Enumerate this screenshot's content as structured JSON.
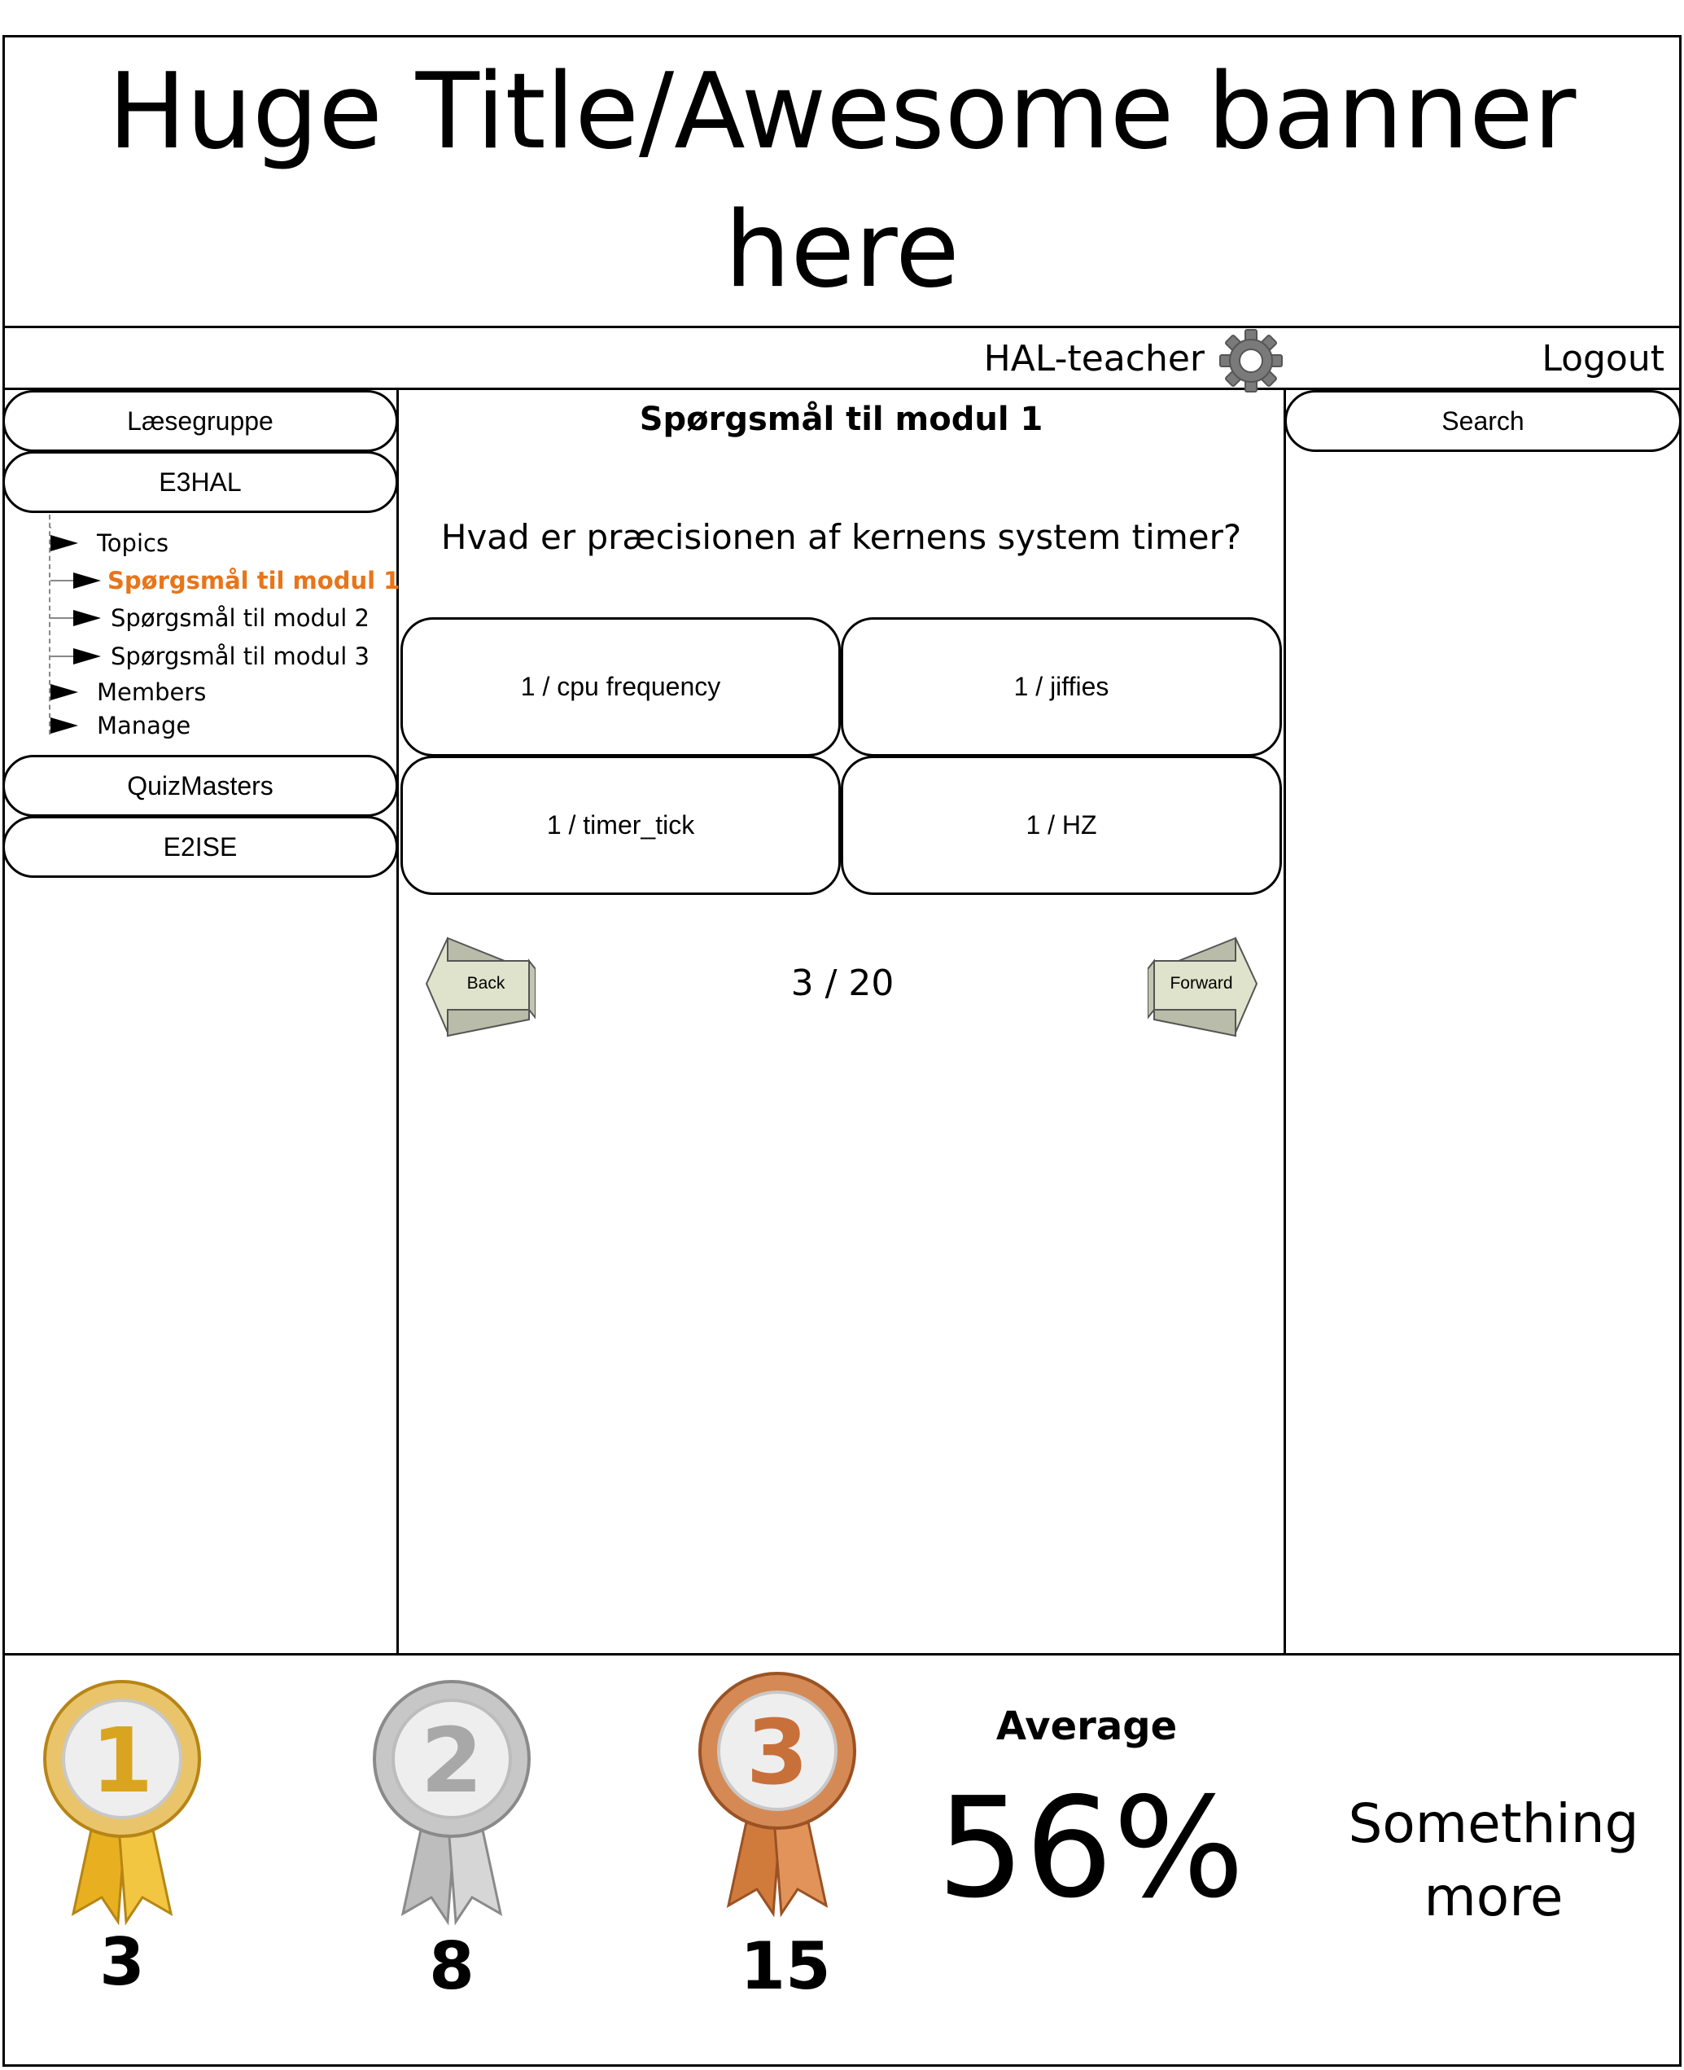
{
  "banner": {
    "title": "Huge Title/Awesome banner here"
  },
  "topbar": {
    "username": "HAL-teacher",
    "settings_icon": "gear-icon",
    "logout_label": "Logout"
  },
  "sidebar": {
    "groups": [
      "Læsegruppe",
      "E3HAL",
      "QuizMasters",
      "E2ISE"
    ],
    "tree": [
      {
        "label": "Topics"
      },
      {
        "label": "Spørgsmål til modul 1",
        "active": true
      },
      {
        "label": "Spørgsmål til modul 2"
      },
      {
        "label": "Spørgsmål til modul 3"
      },
      {
        "label": "Members"
      },
      {
        "label": "Manage"
      }
    ]
  },
  "main": {
    "title": "Spørgsmål til modul 1",
    "question": "Hvad er præcisionen af kernens system timer?",
    "answers": [
      "1 / cpu frequency",
      "1 / jiffies",
      "1 / timer_tick",
      "1 / HZ"
    ],
    "back_label": "Back",
    "forward_label": "Forward",
    "counter": "3 / 20"
  },
  "right": {
    "search_label": "Search"
  },
  "footer": {
    "medals": [
      {
        "rank": "1",
        "count": "3",
        "color": "#D9A520"
      },
      {
        "rank": "2",
        "count": "8",
        "color": "#A8A8A8"
      },
      {
        "rank": "3",
        "count": "15",
        "color": "#C8703A"
      }
    ],
    "average_label": "Average",
    "average_value": "56%",
    "more_text": "Something more"
  },
  "colors": {
    "active_topic": "#E8751A",
    "border": "#000000"
  }
}
